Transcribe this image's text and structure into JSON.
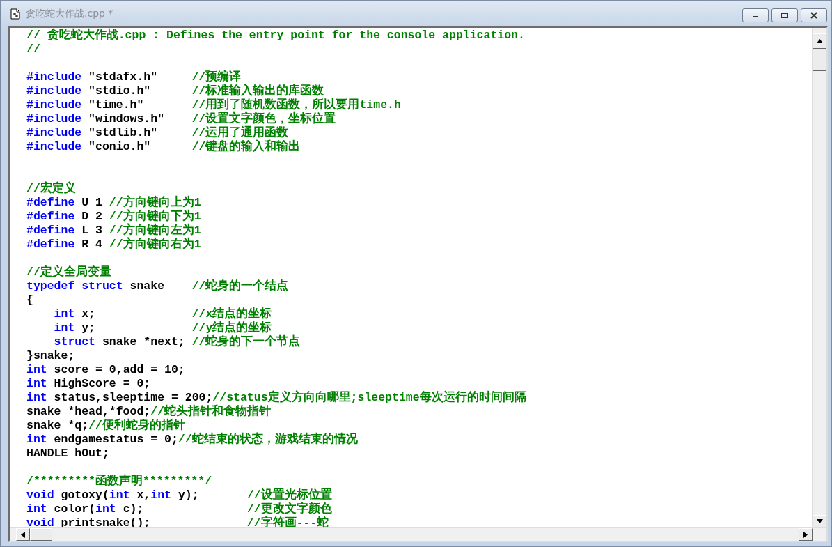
{
  "window": {
    "title": "贪吃蛇大作战.cpp *"
  },
  "editor": {
    "lines": [
      {
        "kind": "code",
        "tokens": [
          {
            "kind": "comment",
            "text": "// 贪吃蛇大作战.cpp : Defines the entry point for the console application."
          }
        ]
      },
      {
        "kind": "code",
        "tokens": [
          {
            "kind": "comment",
            "text": "//"
          }
        ]
      },
      {
        "kind": "blank"
      },
      {
        "kind": "code",
        "tokens": [
          {
            "kind": "keyword",
            "text": "#include"
          },
          {
            "kind": "plain",
            "text": " \"stdafx.h\"     "
          },
          {
            "kind": "comment",
            "text": "//预编译"
          }
        ]
      },
      {
        "kind": "code",
        "tokens": [
          {
            "kind": "keyword",
            "text": "#include"
          },
          {
            "kind": "plain",
            "text": " \"stdio.h\"      "
          },
          {
            "kind": "comment",
            "text": "//标准输入输出的库函数"
          }
        ]
      },
      {
        "kind": "code",
        "tokens": [
          {
            "kind": "keyword",
            "text": "#include"
          },
          {
            "kind": "plain",
            "text": " \"time.h\"       "
          },
          {
            "kind": "comment",
            "text": "//用到了随机数函数，所以要用time.h"
          }
        ]
      },
      {
        "kind": "code",
        "tokens": [
          {
            "kind": "keyword",
            "text": "#include"
          },
          {
            "kind": "plain",
            "text": " \"windows.h\"    "
          },
          {
            "kind": "comment",
            "text": "//设置文字颜色，坐标位置"
          }
        ]
      },
      {
        "kind": "code",
        "tokens": [
          {
            "kind": "keyword",
            "text": "#include"
          },
          {
            "kind": "plain",
            "text": " \"stdlib.h\"     "
          },
          {
            "kind": "comment",
            "text": "//运用了通用函数"
          }
        ]
      },
      {
        "kind": "code",
        "tokens": [
          {
            "kind": "keyword",
            "text": "#include"
          },
          {
            "kind": "plain",
            "text": " \"conio.h\"      "
          },
          {
            "kind": "comment",
            "text": "//键盘的输入和输出"
          }
        ]
      },
      {
        "kind": "blank"
      },
      {
        "kind": "blank"
      },
      {
        "kind": "code",
        "tokens": [
          {
            "kind": "comment",
            "text": "//宏定义"
          }
        ]
      },
      {
        "kind": "code",
        "tokens": [
          {
            "kind": "keyword",
            "text": "#define"
          },
          {
            "kind": "plain",
            "text": " U 1 "
          },
          {
            "kind": "comment",
            "text": "//方向键向上为1"
          }
        ]
      },
      {
        "kind": "code",
        "tokens": [
          {
            "kind": "keyword",
            "text": "#define"
          },
          {
            "kind": "plain",
            "text": " D 2 "
          },
          {
            "kind": "comment",
            "text": "//方向键向下为1"
          }
        ]
      },
      {
        "kind": "code",
        "tokens": [
          {
            "kind": "keyword",
            "text": "#define"
          },
          {
            "kind": "plain",
            "text": " L 3 "
          },
          {
            "kind": "comment",
            "text": "//方向键向左为1"
          }
        ]
      },
      {
        "kind": "code",
        "tokens": [
          {
            "kind": "keyword",
            "text": "#define"
          },
          {
            "kind": "plain",
            "text": " R 4 "
          },
          {
            "kind": "comment",
            "text": "//方向键向右为1"
          }
        ]
      },
      {
        "kind": "blank"
      },
      {
        "kind": "code",
        "tokens": [
          {
            "kind": "comment",
            "text": "//定义全局变量"
          }
        ]
      },
      {
        "kind": "code",
        "tokens": [
          {
            "kind": "keyword",
            "text": "typedef struct"
          },
          {
            "kind": "plain",
            "text": " snake    "
          },
          {
            "kind": "comment",
            "text": "//蛇身的一个结点"
          }
        ]
      },
      {
        "kind": "code",
        "tokens": [
          {
            "kind": "plain",
            "text": "{"
          }
        ]
      },
      {
        "kind": "code",
        "tokens": [
          {
            "kind": "keyword",
            "text": "    int"
          },
          {
            "kind": "plain",
            "text": " x;              "
          },
          {
            "kind": "comment",
            "text": "//x结点的坐标"
          }
        ]
      },
      {
        "kind": "code",
        "tokens": [
          {
            "kind": "keyword",
            "text": "    int"
          },
          {
            "kind": "plain",
            "text": " y;              "
          },
          {
            "kind": "comment",
            "text": "//y结点的坐标"
          }
        ]
      },
      {
        "kind": "code",
        "tokens": [
          {
            "kind": "keyword",
            "text": "    struct"
          },
          {
            "kind": "plain",
            "text": " snake *next; "
          },
          {
            "kind": "comment",
            "text": "//蛇身的下一个节点"
          }
        ]
      },
      {
        "kind": "code",
        "tokens": [
          {
            "kind": "plain",
            "text": "}snake;"
          }
        ]
      },
      {
        "kind": "code",
        "tokens": [
          {
            "kind": "keyword",
            "text": "int"
          },
          {
            "kind": "plain",
            "text": " score = 0,add = 10;"
          }
        ]
      },
      {
        "kind": "code",
        "tokens": [
          {
            "kind": "keyword",
            "text": "int"
          },
          {
            "kind": "plain",
            "text": " HighScore = 0;"
          }
        ]
      },
      {
        "kind": "code",
        "tokens": [
          {
            "kind": "keyword",
            "text": "int"
          },
          {
            "kind": "plain",
            "text": " status,sleeptime = 200;"
          },
          {
            "kind": "comment",
            "text": "//status定义方向向哪里;sleeptime每次运行的时间间隔"
          }
        ]
      },
      {
        "kind": "code",
        "tokens": [
          {
            "kind": "plain",
            "text": "snake *head,*food;"
          },
          {
            "kind": "comment",
            "text": "//蛇头指针和食物指针"
          }
        ]
      },
      {
        "kind": "code",
        "tokens": [
          {
            "kind": "plain",
            "text": "snake *q;"
          },
          {
            "kind": "comment",
            "text": "//便利蛇身的指针"
          }
        ]
      },
      {
        "kind": "code",
        "tokens": [
          {
            "kind": "keyword",
            "text": "int"
          },
          {
            "kind": "plain",
            "text": " endgamestatus = 0;"
          },
          {
            "kind": "comment",
            "text": "//蛇结束的状态，游戏结束的情况"
          }
        ]
      },
      {
        "kind": "code",
        "tokens": [
          {
            "kind": "plain",
            "text": "HANDLE hOut;"
          }
        ]
      },
      {
        "kind": "blank"
      },
      {
        "kind": "code",
        "tokens": [
          {
            "kind": "comment",
            "text": "/*********函数声明*********/"
          }
        ]
      },
      {
        "kind": "code",
        "tokens": [
          {
            "kind": "keyword",
            "text": "void"
          },
          {
            "kind": "plain",
            "text": " gotoxy("
          },
          {
            "kind": "keyword",
            "text": "int"
          },
          {
            "kind": "plain",
            "text": " x,"
          },
          {
            "kind": "keyword",
            "text": "int"
          },
          {
            "kind": "plain",
            "text": " y);       "
          },
          {
            "kind": "comment",
            "text": "//设置光标位置"
          }
        ]
      },
      {
        "kind": "code",
        "tokens": [
          {
            "kind": "keyword",
            "text": "int"
          },
          {
            "kind": "plain",
            "text": " color("
          },
          {
            "kind": "keyword",
            "text": "int"
          },
          {
            "kind": "plain",
            "text": " c);               "
          },
          {
            "kind": "comment",
            "text": "//更改文字颜色"
          }
        ]
      },
      {
        "kind": "code",
        "tokens": [
          {
            "kind": "keyword",
            "text": "void"
          },
          {
            "kind": "plain",
            "text": " printsnake();              "
          },
          {
            "kind": "comment",
            "text": "//字符画---蛇"
          }
        ]
      }
    ]
  }
}
